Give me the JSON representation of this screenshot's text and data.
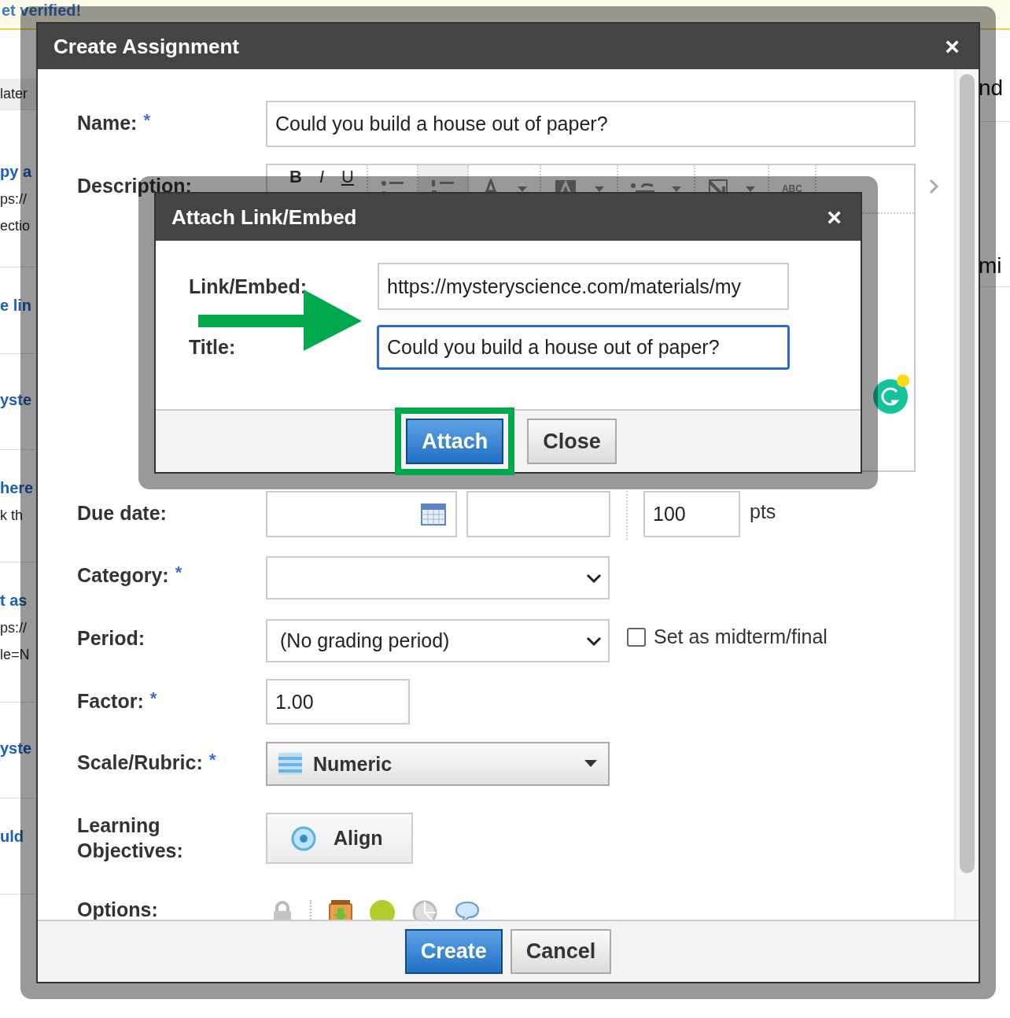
{
  "background_page": {
    "banner": "et verified!",
    "left_items": [
      {
        "kind": "header",
        "title": "later"
      },
      {
        "kind": "item",
        "title": "py a",
        "lines": [
          "ps://",
          "ectio"
        ]
      },
      {
        "kind": "item",
        "title": "e lin"
      },
      {
        "kind": "item",
        "title": "yste"
      },
      {
        "kind": "item",
        "title": "here",
        "lines": [
          "k th"
        ]
      },
      {
        "kind": "item",
        "title": "t as",
        "lines": [
          "ps://",
          "le=N"
        ]
      },
      {
        "kind": "item",
        "title": "yste"
      },
      {
        "kind": "item",
        "title": "uld"
      }
    ],
    "right_items": [
      {
        "title": "nd"
      },
      {
        "title": "mi"
      }
    ]
  },
  "dialog": {
    "title": "Create Assignment",
    "close": "×",
    "fields": [
      {
        "kind": "text",
        "label": "Name:",
        "required_mark": "*",
        "value": "Could you build a house out of paper?"
      },
      {
        "kind": "editor",
        "label": "Description:",
        "toolbar": [
          "B",
          "I",
          "U"
        ],
        "spellcheck": "ABC"
      },
      {
        "kind": "due",
        "label": "Due date:",
        "points": "100",
        "points_unit": "pts"
      },
      {
        "kind": "select",
        "label": "Category:",
        "required_mark": "*"
      },
      {
        "kind": "period",
        "label": "Period:",
        "value": "(No grading period)",
        "checkbox": {
          "label": "Set as midterm/final",
          "checked": false
        }
      },
      {
        "kind": "short",
        "label": "Factor:",
        "required_mark": "*",
        "value": "1.00"
      },
      {
        "kind": "scale",
        "label": "Scale/Rubric:",
        "required_mark": "*",
        "value": "Numeric"
      },
      {
        "kind": "align",
        "label": "Learning Objectives:",
        "button": "Align"
      },
      {
        "kind": "options",
        "label": "Options:"
      }
    ],
    "buttons": [
      {
        "label": "Create",
        "primary": true
      },
      {
        "label": "Cancel",
        "primary": false
      }
    ]
  },
  "attach_dialog": {
    "title": "Attach Link/Embed",
    "close": "×",
    "fields": [
      {
        "label": "Link/Embed:",
        "value": "https://mysteryscience.com/materials/my",
        "focused": false
      },
      {
        "label": "Title:",
        "value": "Could you build a house out of paper?",
        "focused": true
      }
    ],
    "buttons": [
      {
        "label": "Attach",
        "primary": true,
        "highlighted": true
      },
      {
        "label": "Close",
        "primary": false,
        "highlighted": false
      }
    ]
  }
}
